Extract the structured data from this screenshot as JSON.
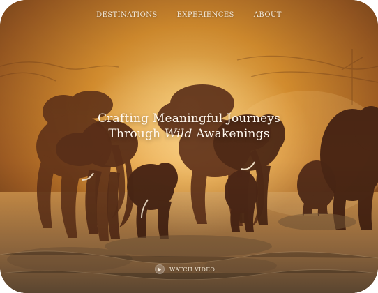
{
  "nav": {
    "destinations": "DESTINATIONS",
    "experiences": "EXPERIENCES",
    "about": "ABOUT"
  },
  "hero": {
    "line1": "Crafting Meaningful Journeys",
    "line2_before": "Through ",
    "line2_wild": "Wild",
    "line2_after": " Awakenings"
  },
  "video": {
    "label": "WATCH VIDEO",
    "icon": "play-icon"
  },
  "colors": {
    "accent": "#c98d39",
    "text": "#fff8ef"
  }
}
